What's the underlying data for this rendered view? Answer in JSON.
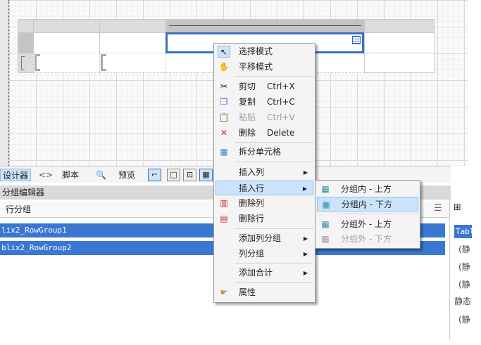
{
  "tabs": {
    "designer": "设计器",
    "code": "<>",
    "script": "脚本",
    "preview": "预览"
  },
  "group_editor": {
    "title": "分组编辑器",
    "row_groups_label": "行分组",
    "rows": [
      "lix2_RowGroup1",
      "blix2_RowGroup2"
    ]
  },
  "right_panel": {
    "items": [
      "Tabl",
      "(静",
      "(静",
      "(静",
      "静态",
      "(静"
    ]
  },
  "context_menu": [
    {
      "label": "选择模式",
      "icon": "pointer-icon",
      "hl": false
    },
    {
      "label": "平移模式",
      "icon": "hand-icon"
    },
    {
      "label": "剪切",
      "shortcut": "Ctrl+X",
      "icon": "scissors-icon"
    },
    {
      "label": "复制",
      "shortcut": "Ctrl+C",
      "icon": "copy-icon"
    },
    {
      "label": "粘贴",
      "shortcut": "Ctrl+V",
      "icon": "paste-icon",
      "disabled": true
    },
    {
      "label": "删除",
      "shortcut": "Delete",
      "icon": "delete-icon"
    },
    {
      "label": "拆分单元格",
      "icon": "split-cells-icon"
    },
    {
      "label": "插入列",
      "submenu": true
    },
    {
      "label": "插入行",
      "submenu": true,
      "highlighted": true
    },
    {
      "label": "删除列",
      "icon": "delete-column-icon"
    },
    {
      "label": "删除行",
      "icon": "delete-row-icon"
    },
    {
      "label": "添加列分组",
      "submenu": true
    },
    {
      "label": "列分组",
      "submenu": true
    },
    {
      "label": "添加合计",
      "submenu": true
    },
    {
      "label": "属性",
      "icon": "properties-icon"
    }
  ],
  "submenu": [
    {
      "label": "分组内 - 上方"
    },
    {
      "label": "分组内 - 下方",
      "highlighted": true
    },
    {
      "label": "分组外 - 上方"
    },
    {
      "label": "分组外 - 下方",
      "disabled": true
    }
  ],
  "colors": {
    "selection": "#3a77d2",
    "menu_highlight": "#cce4fb"
  }
}
